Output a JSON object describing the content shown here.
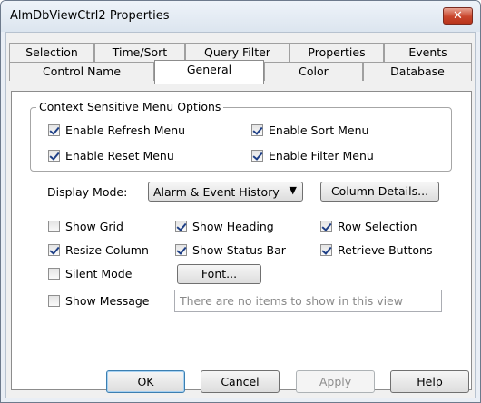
{
  "window": {
    "title": "AlmDbViewCtrl2 Properties",
    "close_glyph": "✕"
  },
  "tabs_row1": [
    "Selection",
    "Time/Sort",
    "Query Filter",
    "Properties",
    "Events"
  ],
  "tabs_row2": [
    "Control Name",
    "General",
    "Color",
    "Database"
  ],
  "active_tab": "General",
  "context_menu": {
    "legend": "Context Sensitive Menu Options",
    "enable_refresh": {
      "label": "Enable Refresh Menu",
      "checked": true
    },
    "enable_sort": {
      "label": "Enable Sort Menu",
      "checked": true
    },
    "enable_reset": {
      "label": "Enable Reset Menu",
      "checked": true
    },
    "enable_filter": {
      "label": "Enable Filter Menu",
      "checked": true
    }
  },
  "display_mode": {
    "label": "Display Mode:",
    "value": "Alarm & Event History",
    "chevron": "▼"
  },
  "column_details_label": "Column Details...",
  "options": {
    "show_grid": {
      "label": "Show Grid",
      "checked": false
    },
    "show_heading": {
      "label": "Show Heading",
      "checked": true
    },
    "row_selection": {
      "label": "Row Selection",
      "checked": true
    },
    "resize_column": {
      "label": "Resize Column",
      "checked": true
    },
    "show_status_bar": {
      "label": "Show Status Bar",
      "checked": true
    },
    "retrieve_buttons": {
      "label": "Retrieve Buttons",
      "checked": true
    },
    "silent_mode": {
      "label": "Silent Mode",
      "checked": false
    },
    "show_message": {
      "label": "Show Message",
      "checked": false
    }
  },
  "font_button_label": "Font...",
  "message_field": {
    "value": "There are no items to show in this view"
  },
  "footer": {
    "ok": "OK",
    "cancel": "Cancel",
    "apply": "Apply",
    "help": "Help"
  }
}
